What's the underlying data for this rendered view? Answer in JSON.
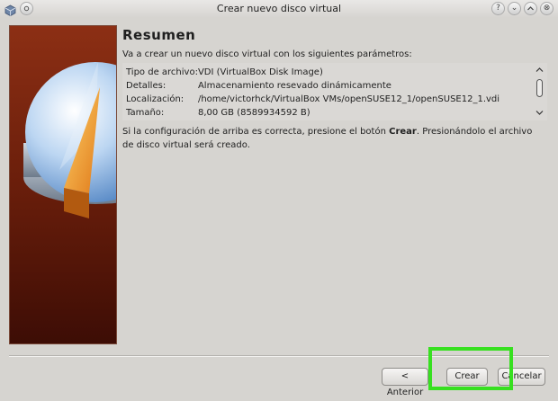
{
  "window": {
    "title": "Crear nuevo disco virtual"
  },
  "titlebar_buttons": {
    "help": "?",
    "minimize": "⌄",
    "close": "⊗"
  },
  "page": {
    "heading": "Resumen",
    "intro": "Va a crear un nuevo disco virtual con los siguientes parámetros:",
    "summary": [
      {
        "key": "Tipo de archivo:",
        "value": "VDI (VirtualBox Disk Image)"
      },
      {
        "key": "Detalles:",
        "value": "Almacenamiento resevado dinámicamente"
      },
      {
        "key": "Localización:",
        "value": "/home/victorhck/VirtualBox VMs/openSUSE12_1/openSUSE12_1.vdi"
      },
      {
        "key": "Tamaño:",
        "value": "8,00 GB (8589934592 B)"
      }
    ],
    "confirm_text_1": "Si la configuración de arriba es correcta, presione el botón",
    "confirm_bold": "Crear",
    "confirm_text_2": ". Presionándolo el archivo de disco virtual será creado."
  },
  "buttons": {
    "back": "< Anterior",
    "create": "Crear",
    "cancel": "Cancelar"
  },
  "colors": {
    "highlight": "#37e020",
    "side_panel": "#7a2510"
  }
}
